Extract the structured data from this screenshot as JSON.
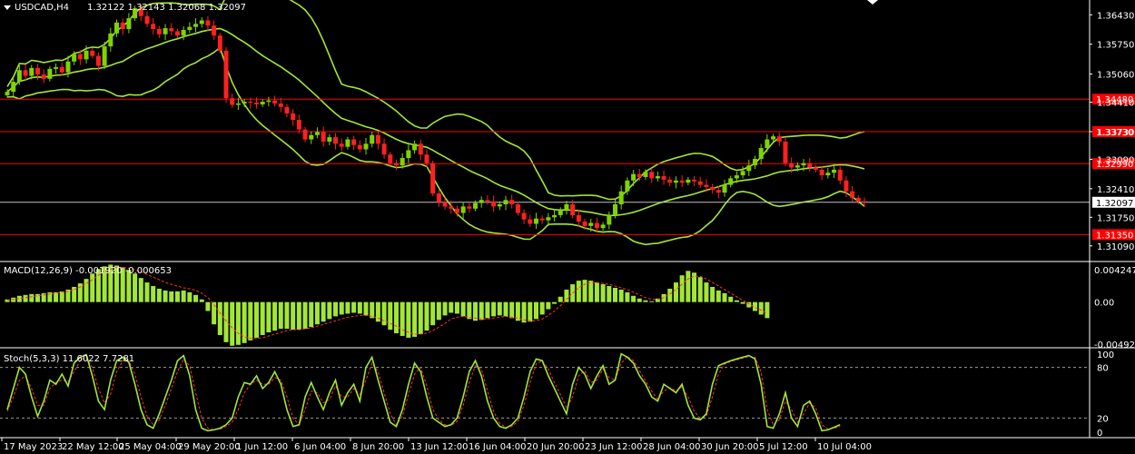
{
  "colors": {
    "background": "#000000",
    "bull": "#7fd400",
    "bear": "#ff2020",
    "band": "#a3e635",
    "level": "#ff0000",
    "macd_hist": "#a3e635",
    "macd_signal": "#ff3030",
    "stoch_main": "#a3e635",
    "stoch_signal": "#ff3030",
    "axis": "#ffffff"
  },
  "header": {
    "symbol": "USDCAD,H4",
    "ohlc": "1.32122 1.32143 1.32068 1.32097"
  },
  "macd_header": "MACD(12,26,9) -0.001920 -0.000653",
  "stoch_header": "Stoch(5,3,3) 11.6022 7.7281",
  "price_axis": [
    "1.36430",
    "1.35750",
    "1.35060",
    "1.34410",
    "1.33730",
    "1.33090",
    "1.32410",
    "1.31750",
    "1.31090"
  ],
  "level_labels": [
    "1.34480",
    "1.33730",
    "1.32990",
    "1.31350"
  ],
  "current_price": "1.32097",
  "macd_axis": [
    "0.004247",
    "0.00",
    "-0.004924"
  ],
  "stoch_axis": [
    "100",
    "80",
    "20",
    "0"
  ],
  "time_axis": [
    "17 May 2023",
    "22 May 12:00",
    "25 May 04:00",
    "29 May 20:00",
    "1 Jun 12:00",
    "6 Jun 04:00",
    "8 Jun 20:00",
    "13 Jun 12:00",
    "16 Jun 04:00",
    "20 Jun 20:00",
    "23 Jun 12:00",
    "28 Jun 04:00",
    "30 Jun 20:00",
    "5 Jul 12:00",
    "10 Jul 04:00"
  ],
  "chart_data": {
    "type": "candlestick",
    "price_range": [
      1.3077,
      1.3673
    ],
    "levels": [
      1.3448,
      1.3373,
      1.3299,
      1.3135
    ],
    "current": 1.32097,
    "closes": [
      1.3465,
      1.3488,
      1.3515,
      1.3502,
      1.352,
      1.3505,
      1.3495,
      1.3518,
      1.3522,
      1.351,
      1.3535,
      1.3552,
      1.354,
      1.356,
      1.3548,
      1.3525,
      1.357,
      1.36,
      1.3625,
      1.361,
      1.3635,
      1.3658,
      1.364,
      1.3622,
      1.361,
      1.3598,
      1.3612,
      1.3605,
      1.3595,
      1.3608,
      1.3615,
      1.3622,
      1.363,
      1.3618,
      1.3595,
      1.356,
      1.345,
      1.3435,
      1.3438,
      1.3442,
      1.344,
      1.3436,
      1.3442,
      1.3445,
      1.3438,
      1.343,
      1.3415,
      1.34,
      1.3378,
      1.3355,
      1.3365,
      1.3372,
      1.335,
      1.336,
      1.3345,
      1.3338,
      1.3355,
      1.3342,
      1.3332,
      1.3345,
      1.3365,
      1.3345,
      1.332,
      1.33,
      1.3295,
      1.3312,
      1.333,
      1.3345,
      1.332,
      1.33,
      1.323,
      1.321,
      1.32,
      1.3195,
      1.3185,
      1.32,
      1.3195,
      1.3208,
      1.3215,
      1.3212,
      1.32,
      1.3205,
      1.3215,
      1.3205,
      1.3185,
      1.317,
      1.316,
      1.3172,
      1.3168,
      1.3175,
      1.318,
      1.3192,
      1.3205,
      1.318,
      1.3165,
      1.3155,
      1.3162,
      1.315,
      1.3158,
      1.318,
      1.3205,
      1.3235,
      1.326,
      1.3275,
      1.3268,
      1.328,
      1.3265,
      1.327,
      1.3262,
      1.3255,
      1.326,
      1.3255,
      1.3262,
      1.3258,
      1.325,
      1.3245,
      1.3238,
      1.3232,
      1.325,
      1.3265,
      1.3272,
      1.3282,
      1.3295,
      1.331,
      1.3335,
      1.3355,
      1.3362,
      1.335,
      1.33,
      1.329,
      1.3295,
      1.33,
      1.329,
      1.3285,
      1.3272,
      1.3278,
      1.3285,
      1.326,
      1.3235,
      1.322,
      1.3212,
      1.32097
    ],
    "macd": {
      "range": [
        -0.004924,
        0.004247
      ],
      "hist": [
        0.0003,
        0.0005,
        0.0007,
        0.0008,
        0.0009,
        0.0009,
        0.001,
        0.0011,
        0.0011,
        0.0012,
        0.0014,
        0.0017,
        0.0021,
        0.0026,
        0.0032,
        0.0037,
        0.004,
        0.0042,
        0.0041,
        0.0039,
        0.0036,
        0.0032,
        0.0027,
        0.0022,
        0.0018,
        0.0015,
        0.0013,
        0.0012,
        0.0012,
        0.0013,
        0.0011,
        0.0008,
        0.0003,
        -0.001,
        -0.0025,
        -0.0037,
        -0.0045,
        -0.0049,
        -0.0048,
        -0.0046,
        -0.0043,
        -0.004,
        -0.0037,
        -0.0034,
        -0.0032,
        -0.003,
        -0.003,
        -0.0031,
        -0.0031,
        -0.003,
        -0.0028,
        -0.0025,
        -0.0022,
        -0.0019,
        -0.0016,
        -0.0014,
        -0.0013,
        -0.0012,
        -0.0013,
        -0.0015,
        -0.0018,
        -0.0022,
        -0.0026,
        -0.0031,
        -0.0035,
        -0.0038,
        -0.004,
        -0.0039,
        -0.0036,
        -0.0032,
        -0.0026,
        -0.002,
        -0.0015,
        -0.0012,
        -0.0013,
        -0.0016,
        -0.0019,
        -0.0021,
        -0.002,
        -0.0018,
        -0.0016,
        -0.0015,
        -0.0016,
        -0.0018,
        -0.0021,
        -0.0023,
        -0.0022,
        -0.0019,
        -0.0014,
        -0.0008,
        -0.0002,
        0.0006,
        0.0014,
        0.002,
        0.0024,
        0.0025,
        0.0024,
        0.0022,
        0.002,
        0.0018,
        0.0016,
        0.0014,
        0.0011,
        0.0007,
        0.0004,
        0.0002,
        0.0001,
        0.0004,
        0.0009,
        0.0015,
        0.0022,
        0.003,
        0.0035,
        0.0033,
        0.0028,
        0.0022,
        0.0017,
        0.0013,
        0.001,
        0.0006,
        0.0002,
        -0.0002,
        -0.0006,
        -0.001,
        -0.0014,
        -0.0018
      ],
      "signal": [
        0.0002,
        0.0003,
        0.0004,
        0.0005,
        0.0006,
        0.0007,
        0.0008,
        0.0009,
        0.001,
        0.0011,
        0.0012,
        0.0014,
        0.0017,
        0.0021,
        0.0025,
        0.003,
        0.0034,
        0.0037,
        0.0039,
        0.0039,
        0.0038,
        0.0036,
        0.0034,
        0.0031,
        0.0028,
        0.0025,
        0.0022,
        0.002,
        0.0018,
        0.0016,
        0.0015,
        0.0013,
        0.001,
        0.0005,
        -0.0003,
        -0.0012,
        -0.0021,
        -0.0029,
        -0.0035,
        -0.0039,
        -0.0041,
        -0.0041,
        -0.004,
        -0.0038,
        -0.0036,
        -0.0034,
        -0.0032,
        -0.0031,
        -0.0031,
        -0.003,
        -0.0029,
        -0.0027,
        -0.0025,
        -0.0023,
        -0.0021,
        -0.0019,
        -0.0017,
        -0.0016,
        -0.0015,
        -0.0015,
        -0.0016,
        -0.0018,
        -0.0021,
        -0.0024,
        -0.0027,
        -0.0031,
        -0.0034,
        -0.0036,
        -0.0036,
        -0.0035,
        -0.0032,
        -0.0028,
        -0.0024,
        -0.0019,
        -0.0017,
        -0.0016,
        -0.0017,
        -0.0018,
        -0.0019,
        -0.0019,
        -0.0018,
        -0.0017,
        -0.0016,
        -0.0017,
        -0.0018,
        -0.002,
        -0.0021,
        -0.0021,
        -0.0019,
        -0.0015,
        -0.001,
        -0.0004,
        0.0003,
        0.001,
        0.0016,
        0.002,
        0.0022,
        0.0022,
        0.0021,
        0.002,
        0.0018,
        0.0016,
        0.0014,
        0.0011,
        0.0008,
        0.0005,
        0.0003,
        0.0003,
        0.0005,
        0.0009,
        0.0014,
        0.002,
        0.0026,
        0.0029,
        0.0029,
        0.0026,
        0.0022,
        0.0018,
        0.0014,
        0.001,
        0.0006,
        0.0002,
        -0.0002,
        -0.0006,
        -0.0009,
        -0.0013
      ]
    },
    "stoch": {
      "range": [
        0,
        100
      ],
      "main": [
        30,
        55,
        80,
        72,
        45,
        22,
        40,
        65,
        60,
        72,
        58,
        85,
        92,
        95,
        70,
        40,
        30,
        65,
        88,
        92,
        86,
        60,
        30,
        12,
        8,
        25,
        45,
        65,
        88,
        94,
        70,
        30,
        8,
        5,
        6,
        8,
        12,
        20,
        45,
        62,
        60,
        70,
        55,
        62,
        75,
        60,
        30,
        10,
        12,
        45,
        62,
        45,
        30,
        50,
        65,
        35,
        50,
        60,
        40,
        80,
        92,
        65,
        40,
        15,
        10,
        30,
        60,
        85,
        75,
        45,
        20,
        15,
        10,
        12,
        20,
        45,
        75,
        88,
        70,
        40,
        20,
        10,
        8,
        12,
        20,
        45,
        75,
        90,
        88,
        70,
        55,
        40,
        25,
        60,
        80,
        72,
        55,
        70,
        82,
        60,
        65,
        96,
        92,
        85,
        70,
        60,
        45,
        40,
        60,
        55,
        50,
        60,
        35,
        20,
        18,
        25,
        60,
        82,
        85,
        88,
        90,
        92,
        94,
        90,
        60,
        10,
        8,
        25,
        50,
        20,
        10,
        35,
        40,
        25,
        5,
        6,
        9,
        12
      ],
      "signal": [
        28,
        45,
        65,
        70,
        55,
        35,
        35,
        55,
        62,
        65,
        63,
        75,
        88,
        92,
        80,
        55,
        38,
        48,
        75,
        88,
        88,
        72,
        45,
        22,
        12,
        18,
        35,
        55,
        75,
        90,
        82,
        50,
        20,
        8,
        6,
        7,
        10,
        15,
        30,
        50,
        60,
        65,
        60,
        60,
        68,
        65,
        45,
        20,
        12,
        30,
        52,
        50,
        38,
        42,
        58,
        45,
        45,
        55,
        48,
        65,
        85,
        75,
        50,
        25,
        12,
        22,
        48,
        72,
        80,
        58,
        30,
        18,
        12,
        11,
        16,
        35,
        62,
        82,
        78,
        52,
        28,
        14,
        9,
        10,
        16,
        35,
        62,
        84,
        88,
        78,
        62,
        48,
        32,
        45,
        70,
        76,
        62,
        65,
        78,
        68,
        65,
        85,
        93,
        88,
        76,
        64,
        52,
        42,
        52,
        56,
        52,
        57,
        45,
        28,
        20,
        22,
        45,
        72,
        84,
        87,
        89,
        91,
        93,
        92,
        75,
        30,
        12,
        18,
        40,
        30,
        15,
        25,
        38,
        32,
        12,
        7,
        8,
        10
      ]
    }
  }
}
